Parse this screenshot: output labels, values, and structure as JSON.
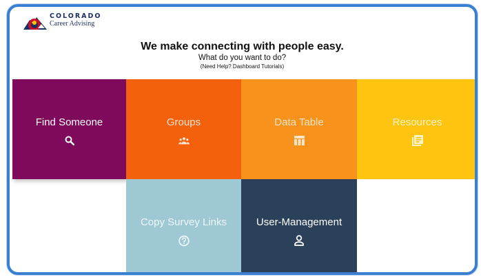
{
  "brand": {
    "title": "COLORADO",
    "subtitle": "Career Advising"
  },
  "header": {
    "headline": "We make connecting with people easy.",
    "subline": "What do you want to do?",
    "help": "(Need Help? Dashboard Tutorials)"
  },
  "tiles": [
    {
      "label": "Find Someone",
      "icon": "search-icon",
      "color": "#7f0a5c"
    },
    {
      "label": "Groups",
      "icon": "people-icon",
      "color": "#f4610c"
    },
    {
      "label": "Data Table",
      "icon": "table-icon",
      "color": "#f7921d"
    },
    {
      "label": "Resources",
      "icon": "document-icon",
      "color": "#fec40f"
    },
    {
      "label": "Copy Survey Links",
      "icon": "help-circle-icon",
      "color": "#9ec9d4"
    },
    {
      "label": "User-Management",
      "icon": "user-icon",
      "color": "#2a4159"
    }
  ],
  "colors": {
    "frame_border": "#3a7fd0"
  }
}
